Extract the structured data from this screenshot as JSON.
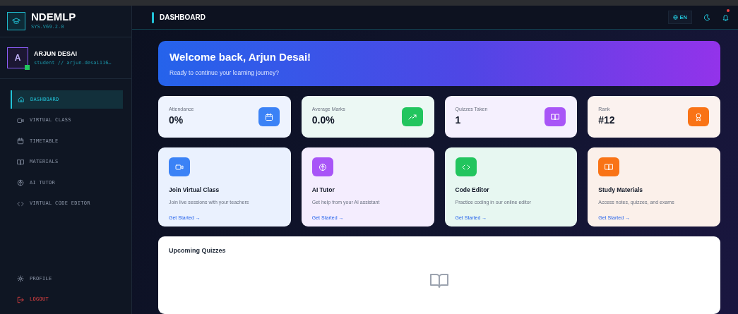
{
  "brand": {
    "name": "NDEMLP",
    "version": "SYS.V69.2.0"
  },
  "user": {
    "initial": "A",
    "name": "ARJUN DESAI",
    "subtitle": "student // arjun.desai116…",
    "online": true
  },
  "nav": [
    {
      "label": "DASHBOARD",
      "selected": true
    },
    {
      "label": "VIRTUAL CLASS",
      "selected": false
    },
    {
      "label": "TIMETABLE",
      "selected": false
    },
    {
      "label": "MATERIALS",
      "selected": false
    },
    {
      "label": "AI TUTOR",
      "selected": false
    },
    {
      "label": "VIRTUAL CODE EDITOR",
      "selected": false
    }
  ],
  "footer_nav": [
    {
      "label": "PROFILE",
      "kind": "normal"
    },
    {
      "label": "LOGOUT",
      "kind": "danger"
    }
  ],
  "header": {
    "title": "DASHBOARD",
    "language": "EN",
    "notification": true
  },
  "welcome": {
    "title": "Welcome back, Arjun Desai!",
    "subtitle": "Ready to continue your learning journey?"
  },
  "stats": [
    {
      "label": "Attendance",
      "value": "0%",
      "color": "#3b82f6"
    },
    {
      "label": "Average Marks",
      "value": "0.0%",
      "color": "#22c55e"
    },
    {
      "label": "Quizzes Taken",
      "value": "1",
      "color": "#a855f7"
    },
    {
      "label": "Rank",
      "value": "#12",
      "color": "#f97316"
    }
  ],
  "actions": [
    {
      "title": "Join Virtual Class",
      "description": "Join live sessions with your teachers",
      "link": "Get Started →",
      "color": "#3b82f6"
    },
    {
      "title": "AI Tutor",
      "description": "Get help from your AI assistant",
      "link": "Get Started →",
      "color": "#a855f7"
    },
    {
      "title": "Code Editor",
      "description": "Practice coding in our online editor",
      "link": "Get Started →",
      "color": "#22c55e"
    },
    {
      "title": "Study Materials",
      "description": "Access notes, quizzes, and exams",
      "link": "Get Started →",
      "color": "#f97316"
    }
  ],
  "upcoming": {
    "title": "Upcoming Quizzes"
  }
}
